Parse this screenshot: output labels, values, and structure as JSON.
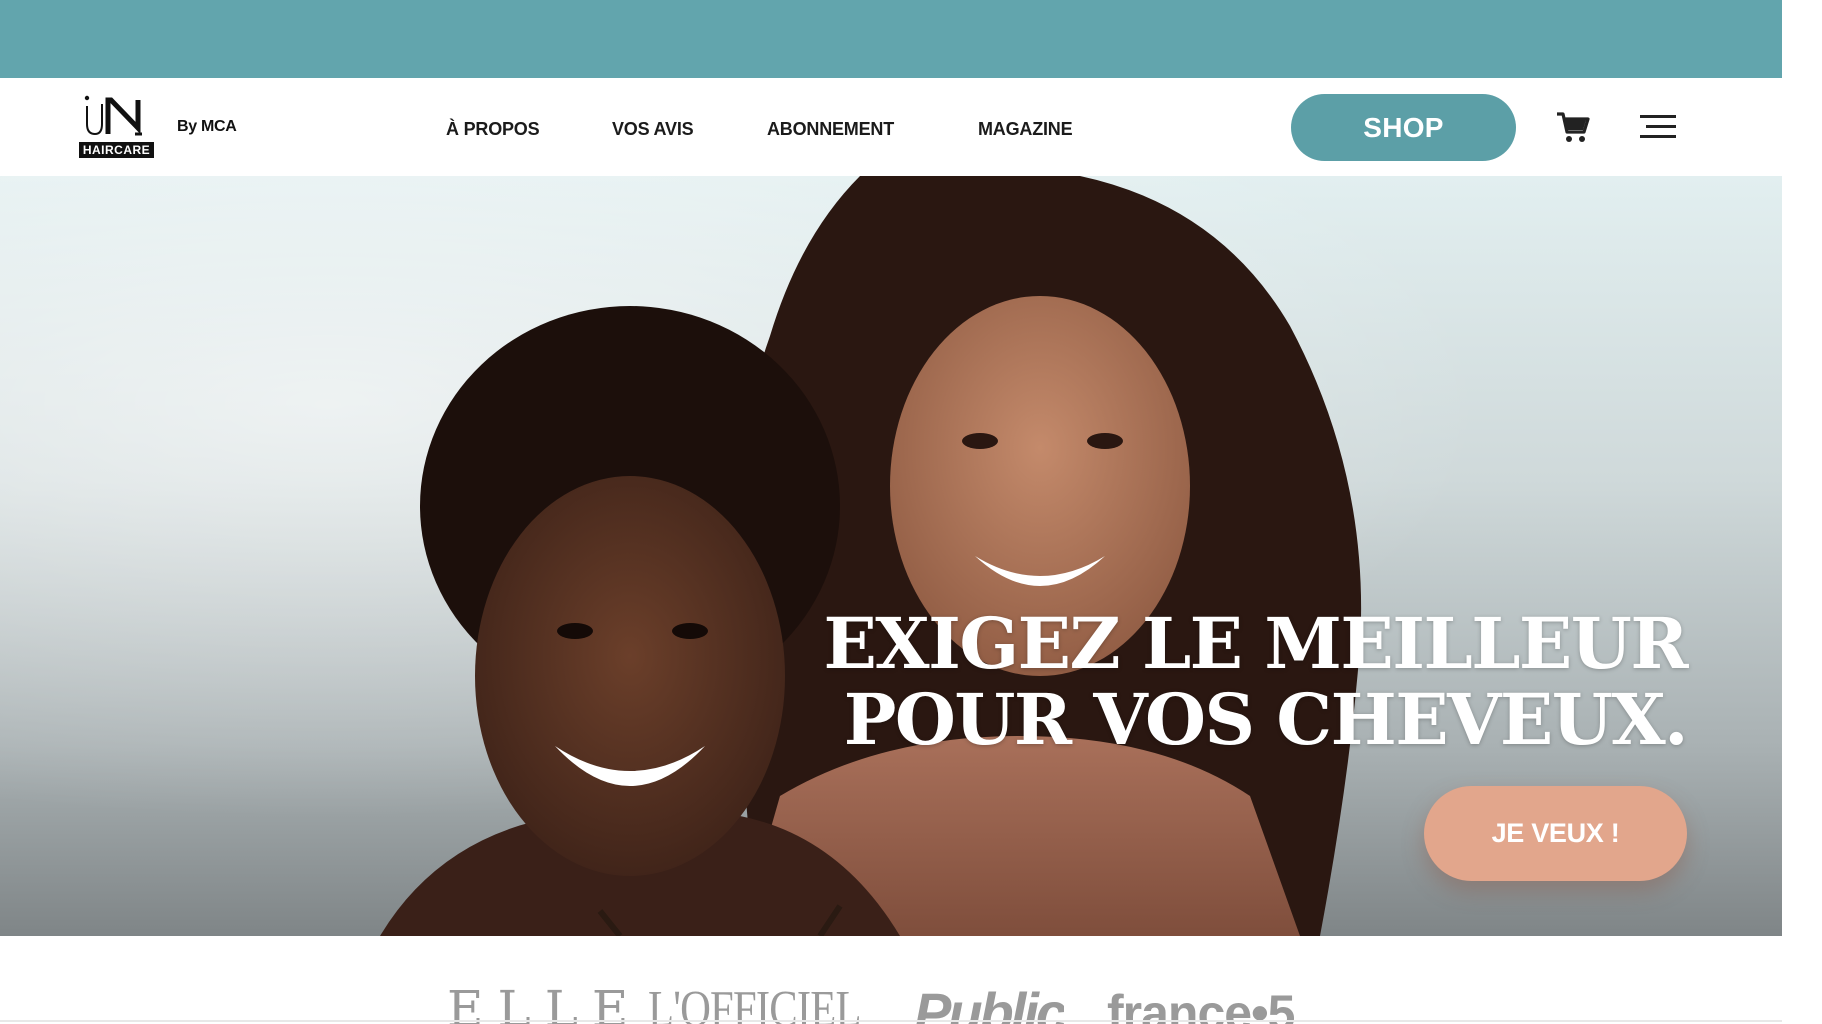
{
  "colors": {
    "accent": "#62a5ad",
    "shop_button": "#5c9fa7",
    "cta_button": "#e2a68c",
    "header_background": "#ffffff",
    "press_logo_gray": "#9a9a9a"
  },
  "brand": {
    "logo_icon": "un-haircare-logo",
    "logo_badge": "HAIRCARE",
    "byline": "By MCA"
  },
  "nav": {
    "items": [
      {
        "label": "À PROPOS"
      },
      {
        "label": "VOS AVIS"
      },
      {
        "label": "ABONNEMENT"
      },
      {
        "label": "MAGAZINE"
      }
    ]
  },
  "header_actions": {
    "shop_label": "SHOP",
    "cart_icon": "cart-icon",
    "menu_icon": "hamburger-menu-icon"
  },
  "hero": {
    "headline_line1": "EXIGEZ LE MEILLEUR",
    "headline_line2": "POUR VOS CHEVEUX.",
    "cta_label": "JE VEUX !"
  },
  "press": {
    "logos": [
      "ELLE",
      "L'OFFICIEL",
      "Public",
      "france•5"
    ]
  }
}
